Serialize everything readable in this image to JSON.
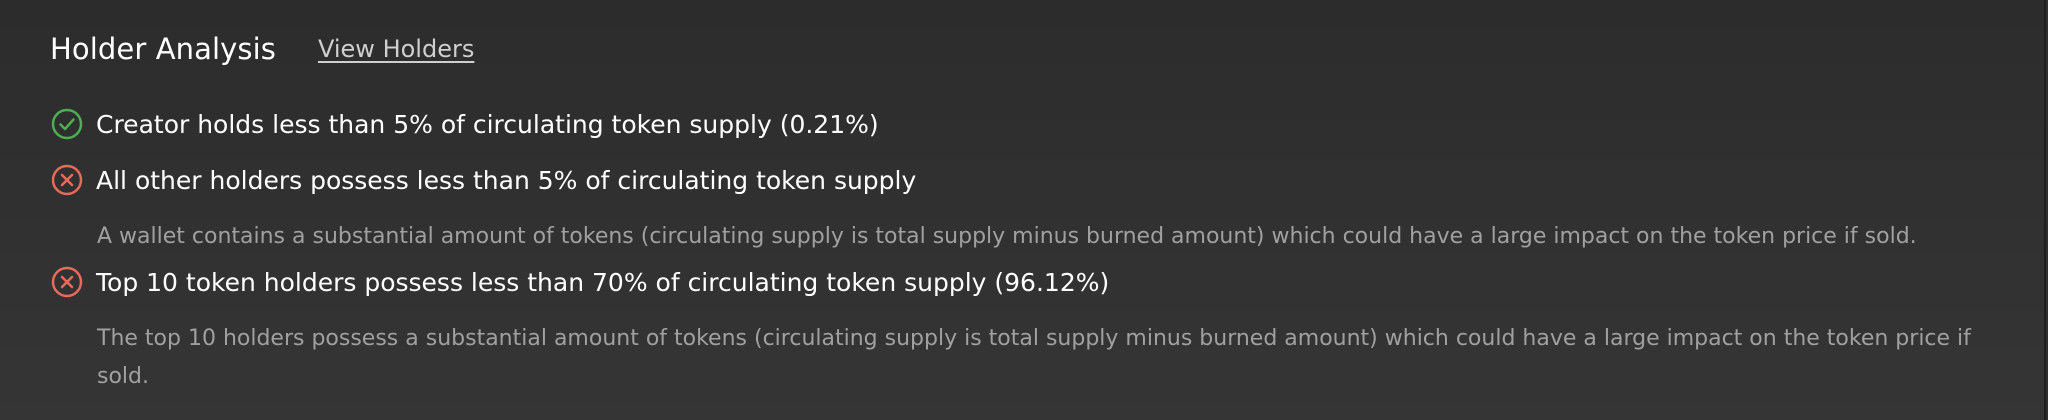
{
  "header": {
    "title": "Holder Analysis",
    "link": "View Holders"
  },
  "checks": [
    {
      "status": "pass",
      "icon": "check-circle-icon",
      "label": "Creator holds less than 5% of circulating token supply (0.21%)"
    },
    {
      "status": "fail",
      "icon": "x-circle-icon",
      "label": "All other holders possess less than 5% of circulating token supply",
      "description": "A wallet contains a substantial amount of tokens (circulating supply is total supply minus burned amount) which could have a large impact on the token price if sold."
    },
    {
      "status": "fail",
      "icon": "x-circle-icon",
      "label": "Top 10 token holders possess less than 70% of circulating token supply (96.12%)",
      "description": "The top 10 holders possess a substantial amount of tokens (circulating supply is total supply minus burned amount) which could have a large impact on the token price if sold."
    }
  ],
  "colors": {
    "pass": "#4caf50",
    "fail": "#e86b5a"
  }
}
